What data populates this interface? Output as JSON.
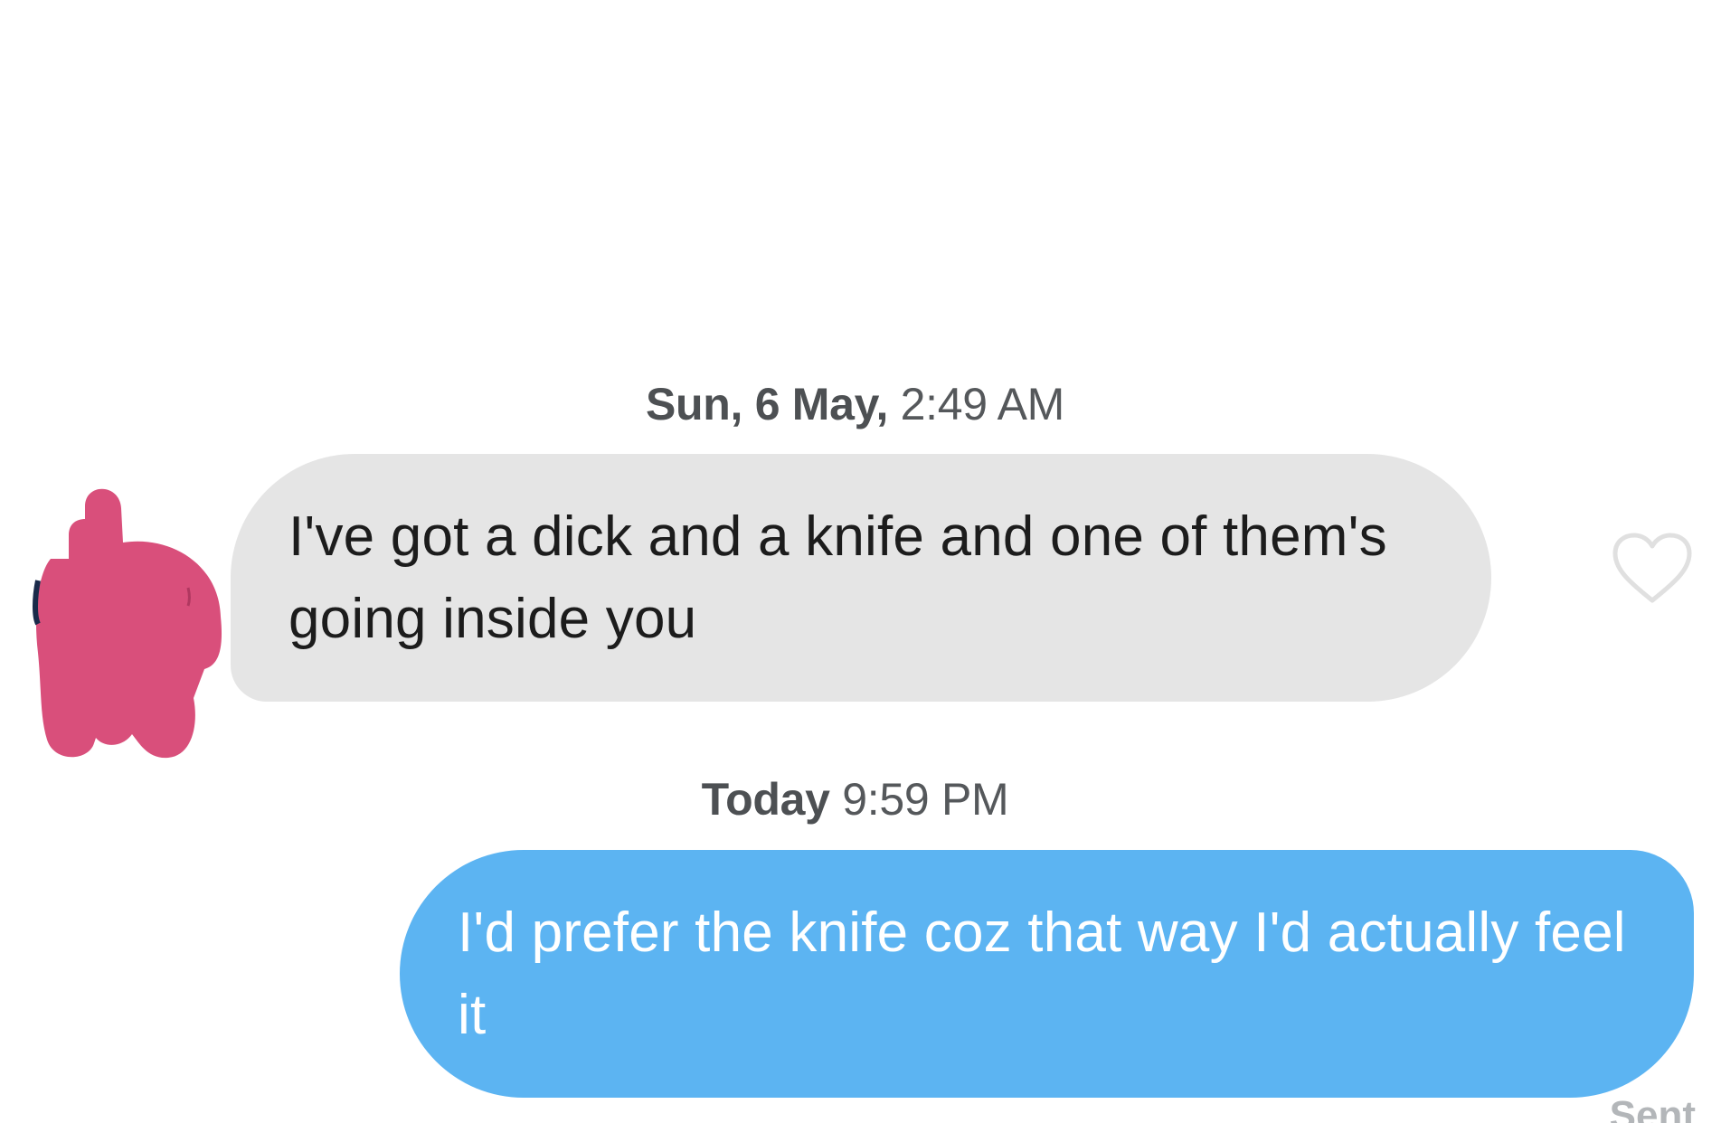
{
  "conversation": {
    "timestamp_1": {
      "day": "Sun, 6 May,",
      "time": "2:49 AM"
    },
    "received_message": "I've got a dick and a knife and one of them's going inside you",
    "timestamp_2": {
      "day": "Today",
      "time": "9:59 PM"
    },
    "sent_message": "I'd prefer the knife coz that way I'd actually feel it",
    "status": "Sent"
  },
  "colors": {
    "received_bubble": "#e5e5e5",
    "sent_bubble": "#5cb4f2",
    "avatar_redaction": "#d94f7b",
    "heart_outline": "#e0e0e0"
  },
  "icons": {
    "avatar": "avatar-redacted-scribble",
    "like": "heart-outline-icon"
  }
}
